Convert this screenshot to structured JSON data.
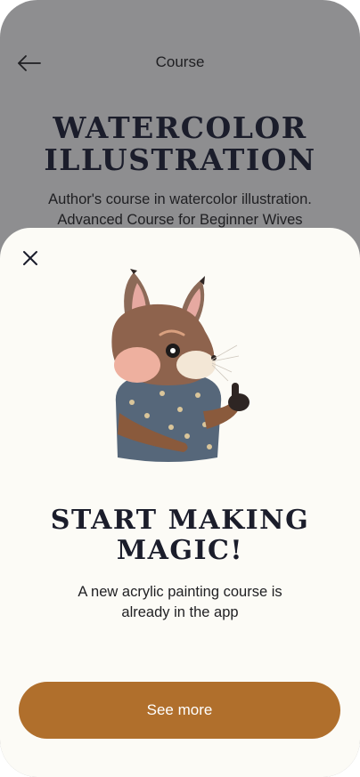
{
  "header": {
    "back_icon": "arrow-left-icon",
    "title": "Course"
  },
  "course": {
    "title": "WATERCOLOR\nILLUSTRATION",
    "description": "Author's course in watercolor illustration.\nAdvanced Course for Beginner Wives"
  },
  "modal": {
    "close_icon": "close-icon",
    "illustration": "squirrel-thumbs-up-illustration",
    "title": "START MAKING\nMAGIC!",
    "description": "A new acrylic painting course is\nalready in the app",
    "button_label": "See more"
  },
  "colors": {
    "overlay_background": "#8e8e90",
    "sheet_background": "#fcfbf6",
    "accent": "#b06f2c",
    "title_text": "#1b1d2b"
  }
}
